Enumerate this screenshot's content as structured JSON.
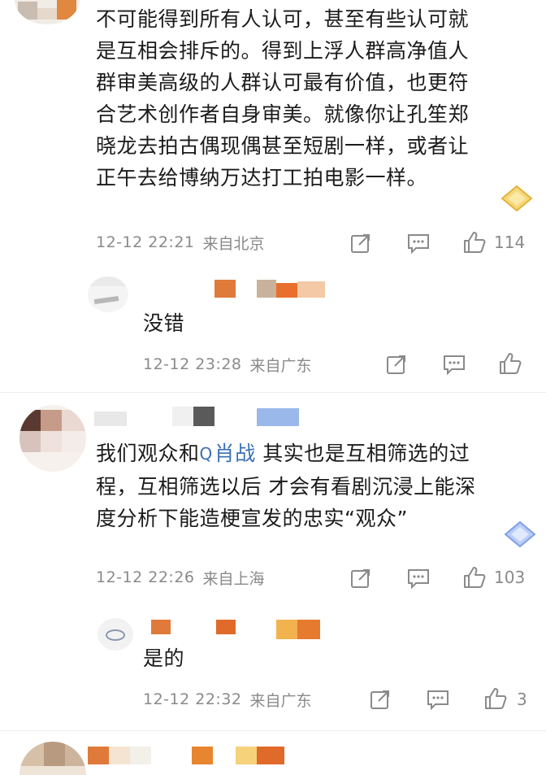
{
  "comments": [
    {
      "lines": [
        "不可能得到所有人认可，甚至有些认可就",
        "是互相会排斥的。得到上浮人群高净值人",
        "群审美高级的人群认可最有价值，也更符",
        "合艺术创作者自身审美。就像你让孔笙郑",
        "晓龙去拍古偶现偶甚至短剧一样，或者让",
        "正午去给博纳万达打工拍电影一样。"
      ],
      "time": "12-12 22:21",
      "location": "来自北京",
      "likes": "114"
    },
    {
      "text": "没错",
      "time": "12-12 23:28",
      "location": "来自广东",
      "likes": ""
    },
    {
      "line1_prefix": "我们观众和",
      "mention": "肖战",
      "line1_suffix": " 其实也是互相筛选的过",
      "line2": "程，互相筛选以后 才会有看剧沉浸上能深",
      "line3": "度分析下能造梗宣发的忠实“观众”",
      "time": "12-12 22:26",
      "location": "来自上海",
      "likes": "103"
    },
    {
      "text": "是的",
      "time": "12-12 22:32",
      "location": "来自广东",
      "likes": "3"
    }
  ],
  "icons": {
    "share": "share-icon",
    "comment": "comment-icon",
    "like": "like-icon",
    "search": "search-icon",
    "badge": "fan-badge-icon"
  },
  "colors": {
    "meta": "#8a8a8a",
    "mention": "#3a6fb5",
    "mosaic_orange": "#e07a3a",
    "mosaic_blue": "#9ab8ea"
  }
}
